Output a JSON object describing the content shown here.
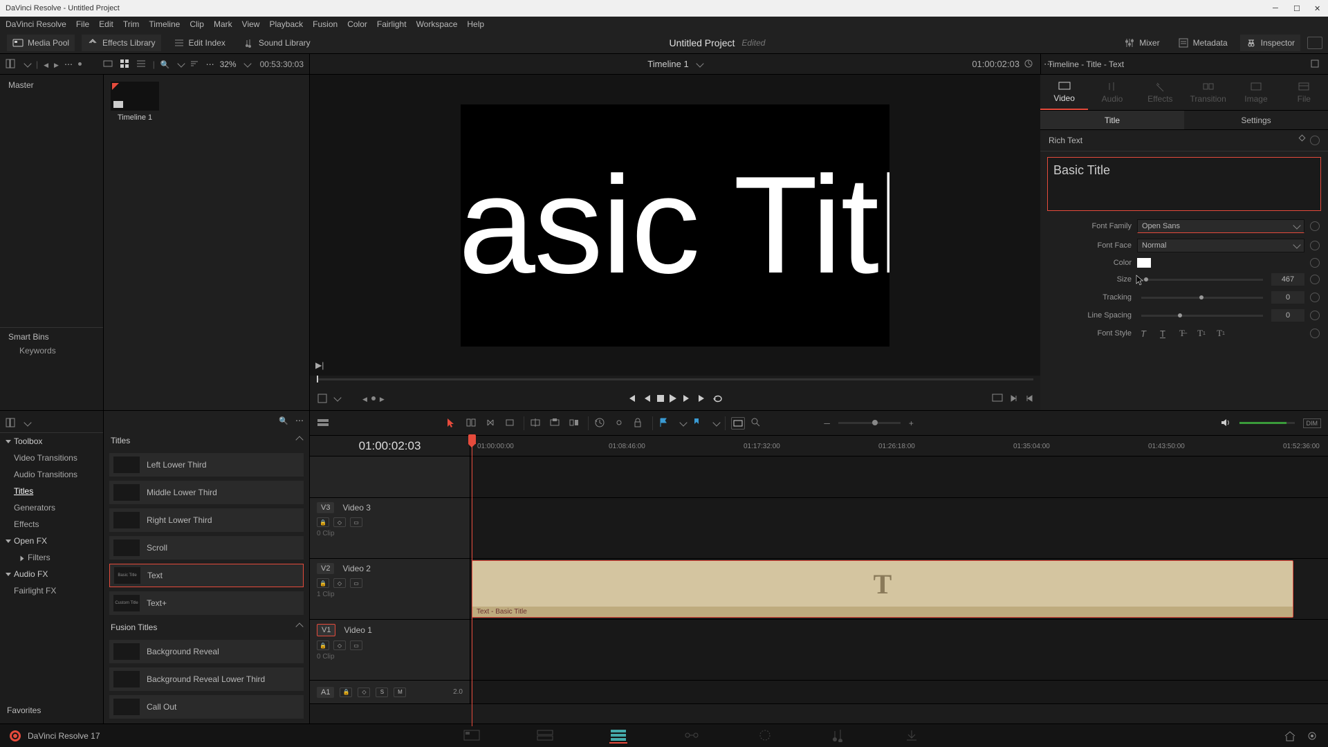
{
  "titlebar": {
    "title": "DaVinci Resolve - Untitled Project"
  },
  "menubar": [
    "DaVinci Resolve",
    "File",
    "Edit",
    "Trim",
    "Timeline",
    "Clip",
    "Mark",
    "View",
    "Playback",
    "Fusion",
    "Color",
    "Fairlight",
    "Workspace",
    "Help"
  ],
  "toptoolbar": {
    "media_pool": "Media Pool",
    "effects_library": "Effects Library",
    "edit_index": "Edit Index",
    "sound_library": "Sound Library",
    "mixer": "Mixer",
    "metadata": "Metadata",
    "inspector": "Inspector"
  },
  "project": {
    "name": "Untitled Project",
    "status": "Edited"
  },
  "subbar": {
    "zoom_pct": "32%",
    "source_tc": "00:53:30:03",
    "timeline_name": "Timeline 1",
    "record_tc": "01:00:02:03",
    "inspector_title": "Timeline - Title - Text"
  },
  "media": {
    "master": "Master",
    "smart_bins": "Smart Bins",
    "keywords": "Keywords",
    "thumb_label": "Timeline 1"
  },
  "viewer": {
    "title_text": "Basic Title"
  },
  "inspector": {
    "tabs": [
      "Video",
      "Audio",
      "Effects",
      "Transition",
      "Image",
      "File"
    ],
    "subtabs": [
      "Title",
      "Settings"
    ],
    "section": "Rich Text",
    "text_value": "Basic Title",
    "font_family_label": "Font Family",
    "font_family": "Open Sans",
    "font_face_label": "Font Face",
    "font_face": "Normal",
    "color_label": "Color",
    "color": "#ffffff",
    "size_label": "Size",
    "size": "467",
    "tracking_label": "Tracking",
    "tracking": "0",
    "line_spacing_label": "Line Spacing",
    "line_spacing": "0",
    "font_style_label": "Font Style"
  },
  "fx_tree": {
    "toolbox": "Toolbox",
    "video_transitions": "Video Transitions",
    "audio_transitions": "Audio Transitions",
    "titles": "Titles",
    "generators": "Generators",
    "effects": "Effects",
    "openfx": "Open FX",
    "filters": "Filters",
    "audiofx": "Audio FX",
    "fairlight_fx": "Fairlight FX",
    "favorites": "Favorites"
  },
  "titles": {
    "header": "Titles",
    "fusion_header": "Fusion Titles",
    "items": [
      {
        "label": "Left Lower Third",
        "thumb": ""
      },
      {
        "label": "Middle Lower Third",
        "thumb": ""
      },
      {
        "label": "Right Lower Third",
        "thumb": ""
      },
      {
        "label": "Scroll",
        "thumb": ""
      },
      {
        "label": "Text",
        "thumb": "Basic Title"
      },
      {
        "label": "Text+",
        "thumb": "Custom Title"
      }
    ],
    "fusion_items": [
      {
        "label": "Background Reveal"
      },
      {
        "label": "Background Reveal Lower Third"
      },
      {
        "label": "Call Out"
      }
    ]
  },
  "timeline": {
    "current_tc": "01:00:02:03",
    "ruler": [
      "01:00:00:00",
      "01:08:46:00",
      "01:17:32:00",
      "01:26:18:00",
      "01:35:04:00",
      "01:43:50:00",
      "01:52:36:00"
    ],
    "tracks": {
      "v3": {
        "tag": "V3",
        "name": "Video 3",
        "clips": "0 Clip"
      },
      "v2": {
        "tag": "V2",
        "name": "Video 2",
        "clips": "1 Clip"
      },
      "v1": {
        "tag": "V1",
        "name": "Video 1",
        "clips": "0 Clip"
      },
      "a1": {
        "tag": "A1",
        "level": "2.0"
      }
    },
    "clip_label": "Text - Basic Title"
  },
  "pagebar": {
    "app_label": "DaVinci Resolve 17"
  }
}
